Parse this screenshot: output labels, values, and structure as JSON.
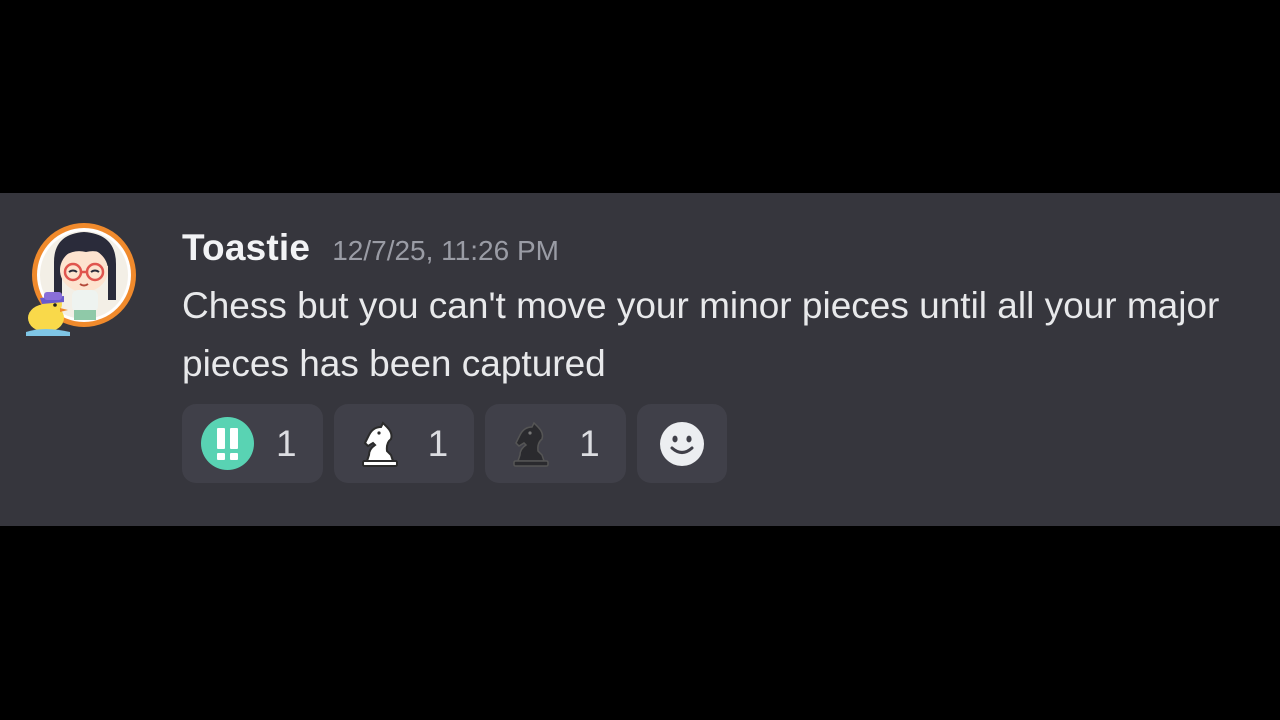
{
  "message": {
    "username": "Toastie",
    "timestamp": "12/7/25, 11:26 PM",
    "text": "Chess but you can't move your minor pieces until all your major pieces has been captured"
  },
  "reactions": [
    {
      "icon": "double-exclamation-icon",
      "count": "1"
    },
    {
      "icon": "white-knight-icon",
      "count": "1"
    },
    {
      "icon": "black-knight-icon",
      "count": "1"
    }
  ],
  "add_reaction": {
    "icon": "smiley-icon"
  },
  "colors": {
    "background": "#000000",
    "message_bg": "#36363d",
    "reaction_bg": "#404049",
    "accent_teal": "#59d3b3",
    "username": "#f2f3f5",
    "timestamp": "#9a9ca5"
  }
}
